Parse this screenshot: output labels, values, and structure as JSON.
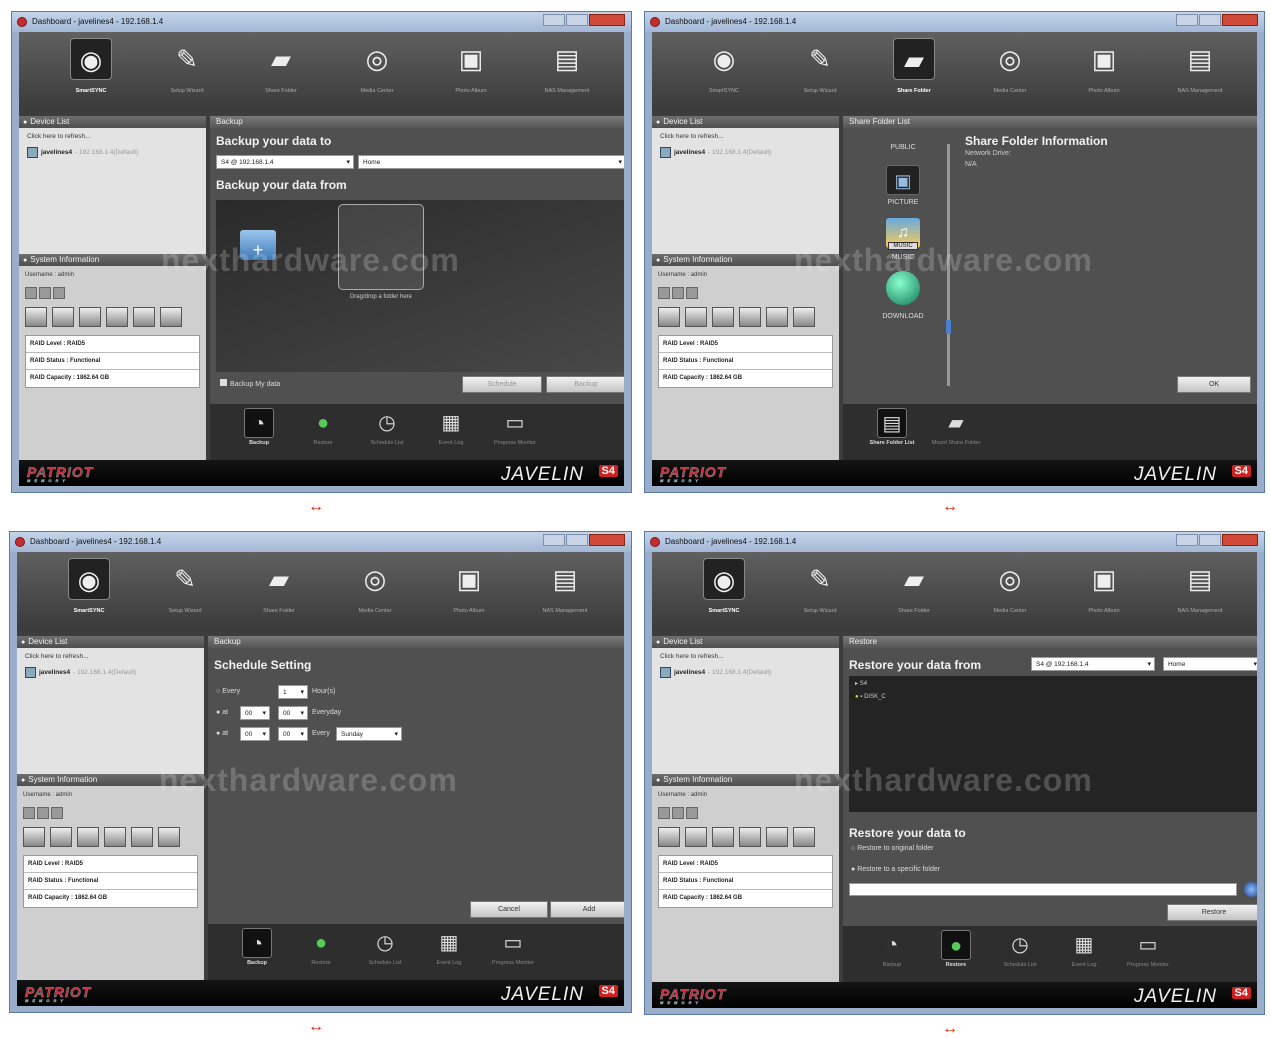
{
  "window_title": "Dashboard - javelines4 - 192.168.1.4",
  "toolbar": [
    "SmartSYNC",
    "Setup Wizard",
    "Share Folder",
    "Media Center",
    "Photo Album",
    "NAS Management"
  ],
  "left": {
    "device_list_title": "Device List",
    "refresh_text": "Click here to refresh...",
    "device_name": "javelines4",
    "device_ip": " - 192.168.1.4(Default)",
    "sys_info_title": "System Information",
    "username": "Username : admin",
    "raid_level": "RAID Level : RAID5",
    "raid_status": "RAID Status : Functional",
    "raid_capacity": "RAID Capacity : 1862.64 GB"
  },
  "bottom_tools": [
    "Backup",
    "Restore",
    "Schedule List",
    "Event Log",
    "Progress Monitor"
  ],
  "share_bottom_tools": [
    "Share Folder List",
    "Mount Share Folder"
  ],
  "brand": {
    "patriot": "PATRIOT",
    "memory": "MEMORY",
    "javelin": "JAVELIN",
    "s4": "S4",
    "watermark": "nexthardware.com"
  },
  "arrow": "↔",
  "panel1": {
    "header": "Backup",
    "to_title": "Backup your data to",
    "dest_device": "S4 @ 192.168.1.4",
    "dest_folder": "Home",
    "from_title": "Backup your data from",
    "drag_text": "Drag/drop a folder here",
    "checkbox": "Backup My data",
    "schedule_btn": "Schedule",
    "backup_btn": "Backup"
  },
  "panel2": {
    "header": "Share Folder List",
    "folders": [
      "PUBLIC",
      "PICTURE",
      "MUSIC",
      "DOWNLOAD"
    ],
    "music_tag": "MUSIC",
    "info_title": "Share Folder Information",
    "network_drive": "Network Drive:",
    "na": "N/A",
    "ok_btn": "OK"
  },
  "panel3": {
    "header": "Backup",
    "title": "Schedule Setting",
    "every_label": "Every",
    "every_value": "1",
    "hours": "Hour(s)",
    "at_label": "at",
    "hh": "00",
    "mm": "00",
    "everyday": "Everyday",
    "every_day_label": "Every",
    "weekday": "Sunday",
    "cancel_btn": "Cancel",
    "add_btn": "Add"
  },
  "panel4": {
    "header": "Restore",
    "from_title": "Restore your data from",
    "device": "S4 @ 192.168.1.4",
    "folder": "Home",
    "tree_root": "S4",
    "tree_child": "DISK_C",
    "to_title": "Restore your data to",
    "opt1": "Restore to original folder",
    "opt2": "Restore to a specific folder",
    "restore_btn": "Restore"
  }
}
